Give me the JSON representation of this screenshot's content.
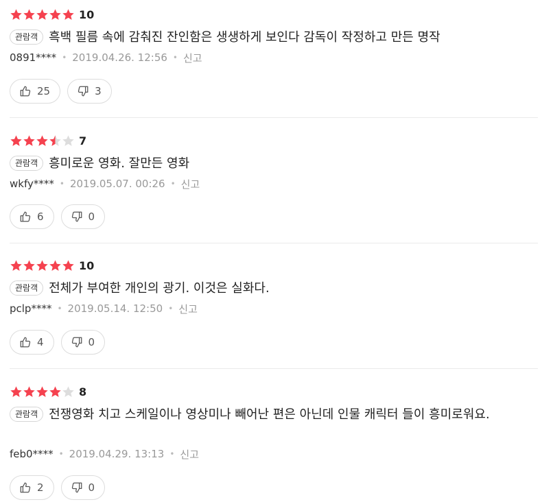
{
  "colors": {
    "star_on": "#f5424f",
    "star_off": "#dddddd"
  },
  "reviews": [
    {
      "rating_stars": 5,
      "score": "10",
      "badge": "관람객",
      "comment": "흑백 필름 속에 감춰진 잔인함은 생생하게 보인다 감독이 작정하고 만든 명작",
      "user": "0891****",
      "date": "2019.04.26. 12:56",
      "report": "신고",
      "likes": "25",
      "dislikes": "3"
    },
    {
      "rating_stars": 3.5,
      "score": "7",
      "badge": "관람객",
      "comment": "흥미로운 영화. 잘만든 영화",
      "user": "wkfy****",
      "date": "2019.05.07. 00:26",
      "report": "신고",
      "likes": "6",
      "dislikes": "0"
    },
    {
      "rating_stars": 5,
      "score": "10",
      "badge": "관람객",
      "comment": "전체가 부여한 개인의 광기. 이것은 실화다.",
      "user": "pclp****",
      "date": "2019.05.14. 12:50",
      "report": "신고",
      "likes": "4",
      "dislikes": "0"
    },
    {
      "rating_stars": 4,
      "score": "8",
      "badge": "관람객",
      "comment": "전쟁영화 치고 스케일이나 영상미나 빼어난 편은 아닌데 인물 캐릭터 들이 흥미로워요.",
      "user": "feb0****",
      "date": "2019.04.29. 13:13",
      "report": "신고",
      "likes": "2",
      "dislikes": "0"
    }
  ]
}
